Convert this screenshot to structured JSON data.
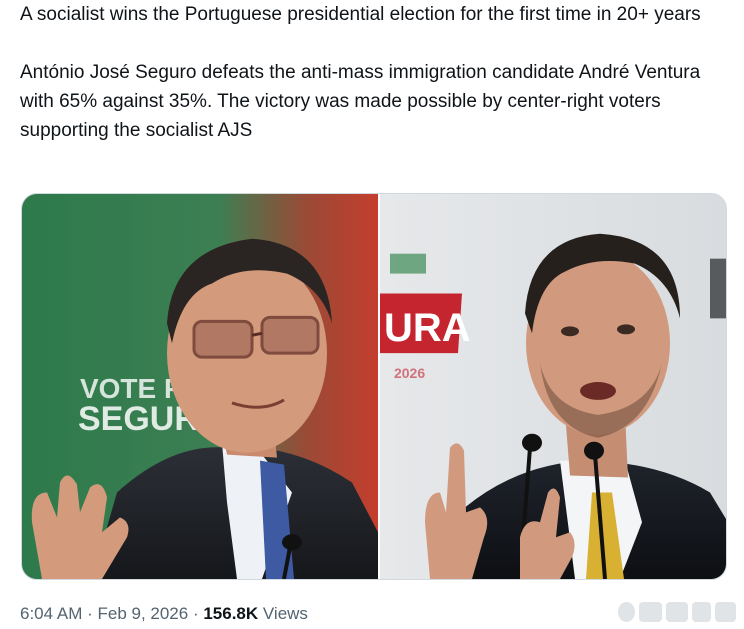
{
  "post": {
    "headline": "A socialist wins the Portuguese presidential election for the first time in 20+ years",
    "body": "António José Seguro defeats the anti-mass immigration candidate André Ventura with 65% against 35%. The victory was made possible by center-right voters supporting  the socialist AJS"
  },
  "media": {
    "left_sign_line1": "VOTE PEL",
    "left_sign_line2": "SEGURO",
    "right_sign_text": "URA",
    "right_sign_year": "2026",
    "left_bg_color": "#2e7a4a",
    "left_accent_color": "#c2402f",
    "right_bg_color": "#e9ecef",
    "right_accent_color": "#c4252f"
  },
  "meta": {
    "time": "6:04 AM",
    "separator1": " · ",
    "date": "Feb 9, 2026",
    "separator2": " · ",
    "views_count": "156.8K",
    "views_label": " Views"
  }
}
